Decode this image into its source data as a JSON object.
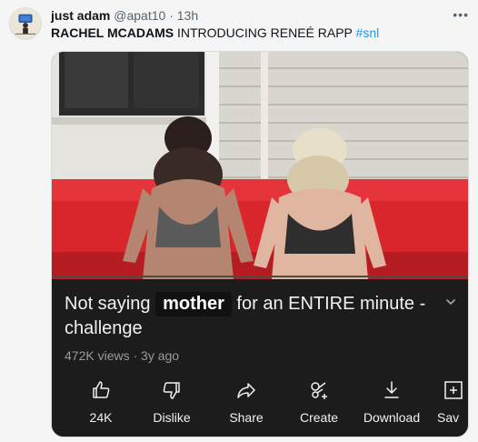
{
  "tweet": {
    "display_name": "just adam",
    "handle": "@apat10",
    "separator": "·",
    "time": "13h",
    "more_icon": "more-dots-icon",
    "text_caps": "RACHEL MCADAMS",
    "text_rest": "INTRODUCING RENEÉ RAPP",
    "hashtag": "#snl"
  },
  "video": {
    "title_before": "Not saying",
    "title_highlight": "mother",
    "title_after": "for an ENTIRE minute - challenge",
    "meta": "472K views · 3y ago",
    "actions": [
      {
        "label": "24K",
        "icon": "thumbs-up-icon"
      },
      {
        "label": "Dislike",
        "icon": "thumbs-down-icon"
      },
      {
        "label": "Share",
        "icon": "share-icon"
      },
      {
        "label": "Create",
        "icon": "create-icon"
      },
      {
        "label": "Download",
        "icon": "download-icon"
      },
      {
        "label": "Sav",
        "icon": "save-icon"
      }
    ]
  },
  "colors": {
    "hashtag": "#1d9bf0",
    "video_panel": "#1c1c1c",
    "couch": "#e0202a"
  }
}
